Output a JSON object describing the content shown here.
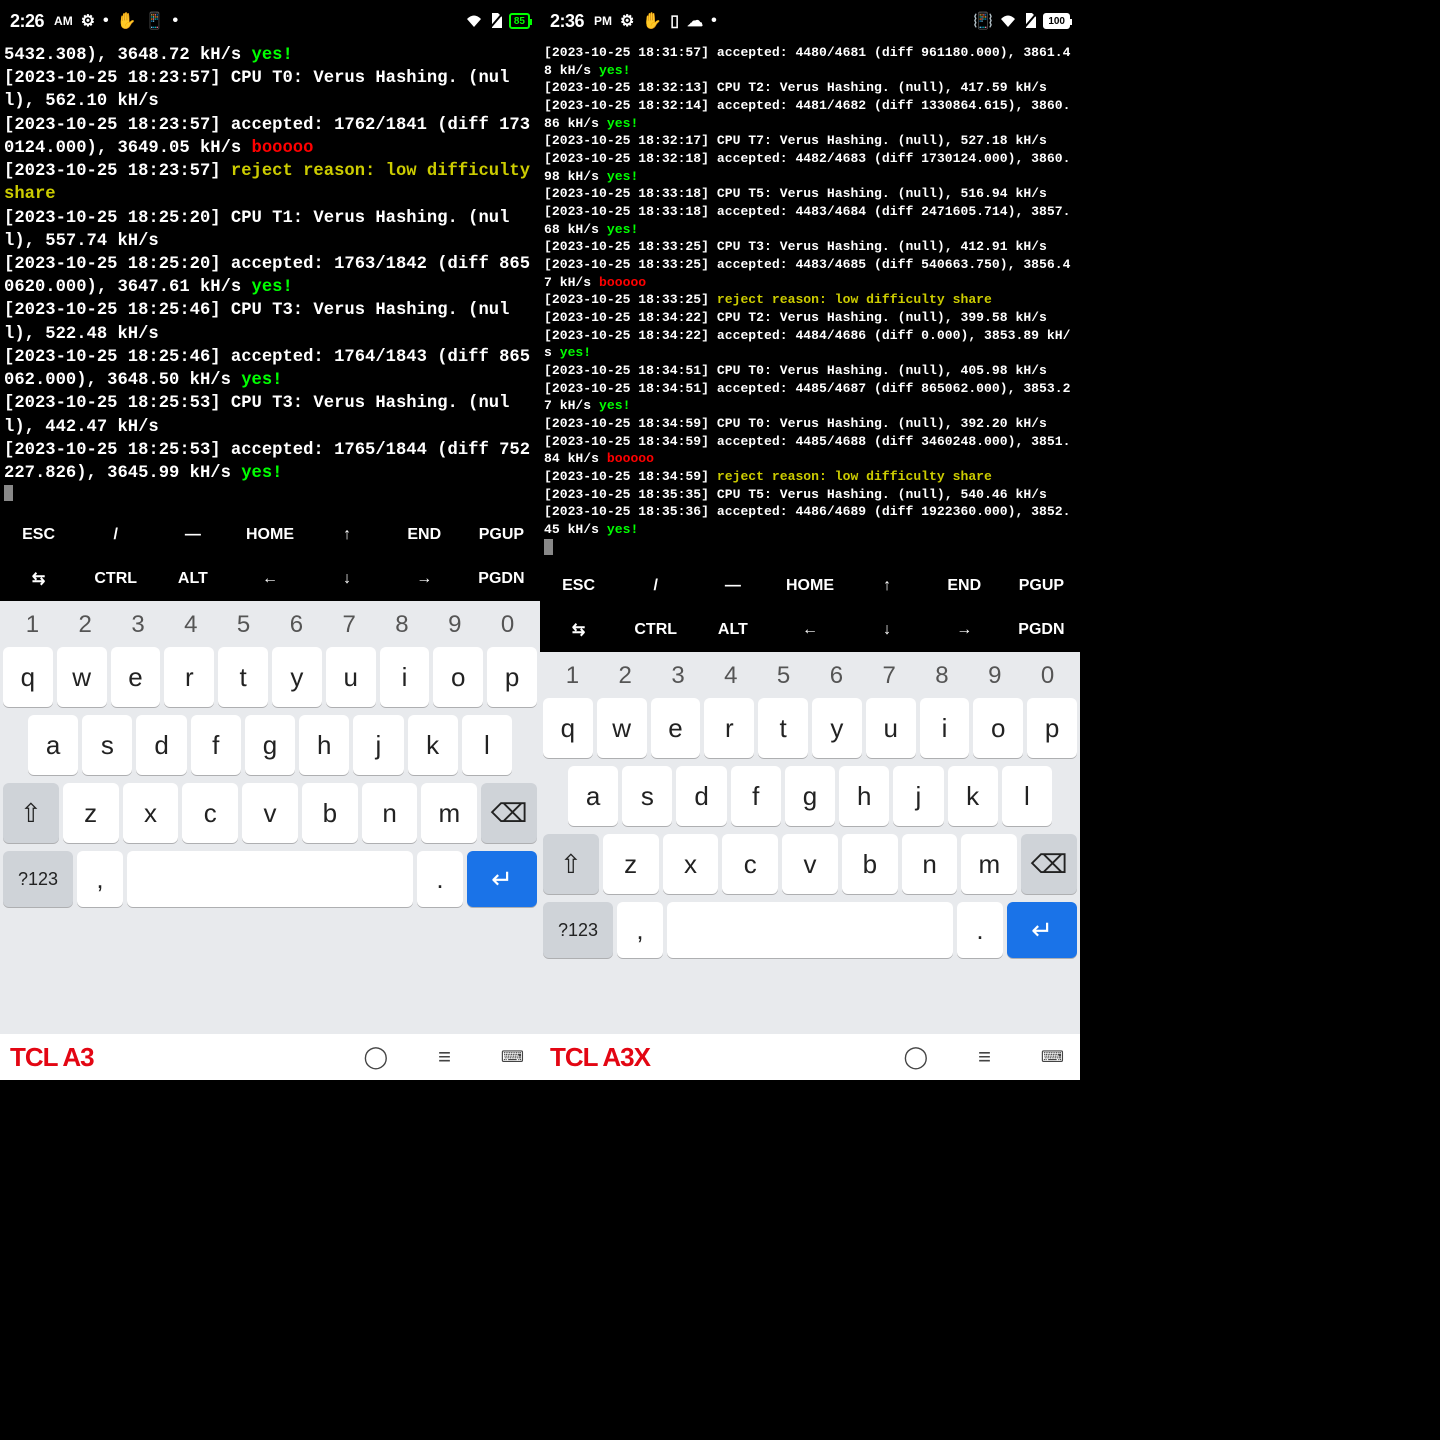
{
  "left": {
    "status": {
      "time": "2:26",
      "ampm": "AM",
      "batt": "85"
    },
    "fn": [
      "ESC",
      "/",
      "—",
      "HOME",
      "↑",
      "END",
      "PGUP"
    ],
    "fn2": [
      "⇆",
      "CTRL",
      "ALT",
      "←",
      "↓",
      "→",
      "PGDN"
    ],
    "numrow": [
      "1",
      "2",
      "3",
      "4",
      "5",
      "6",
      "7",
      "8",
      "9",
      "0"
    ],
    "row1": [
      "q",
      "w",
      "e",
      "r",
      "t",
      "y",
      "u",
      "i",
      "o",
      "p"
    ],
    "row2": [
      "a",
      "s",
      "d",
      "f",
      "g",
      "h",
      "j",
      "k",
      "l"
    ],
    "row3": [
      "z",
      "x",
      "c",
      "v",
      "b",
      "n",
      "m"
    ],
    "sym": "?123",
    "brand": "TCL A3",
    "lines": [
      {
        "pre": "5432.308), 3648.72 kH/s ",
        "tag": "yes!",
        "cls": "y"
      },
      {
        "ts": "[2023-10-25 18:23:57] ",
        "txt": "CPU T0: Verus Hashing. (null), 562.10 kH/s"
      },
      {
        "ts": "[2023-10-25 18:23:57] ",
        "txt": "accepted: 1762/1841 (diff 1730124.000), 3649.05 kH/s ",
        "tag": "booooo",
        "cls": "b"
      },
      {
        "ts": "[2023-10-25 18:23:57] ",
        "rj": "reject reason: low difficulty share"
      },
      {
        "ts": "[2023-10-25 18:25:20] ",
        "txt": "CPU T1: Verus Hashing. (null), 557.74 kH/s"
      },
      {
        "ts": "[2023-10-25 18:25:20] ",
        "txt": "accepted: 1763/1842 (diff 8650620.000), 3647.61 kH/s ",
        "tag": "yes!",
        "cls": "y"
      },
      {
        "ts": "[2023-10-25 18:25:46] ",
        "txt": "CPU T3: Verus Hashing. (null), 522.48 kH/s"
      },
      {
        "ts": "[2023-10-25 18:25:46] ",
        "txt": "accepted: 1764/1843 (diff 865062.000), 3648.50 kH/s ",
        "tag": "yes!",
        "cls": "y"
      },
      {
        "ts": "[2023-10-25 18:25:53] ",
        "txt": "CPU T3: Verus Hashing. (null), 442.47 kH/s"
      },
      {
        "ts": "[2023-10-25 18:25:53] ",
        "txt": "accepted: 1765/1844 (diff 752227.826), 3645.99 kH/s ",
        "tag": "yes!",
        "cls": "y"
      }
    ]
  },
  "right": {
    "status": {
      "time": "2:36",
      "ampm": "PM",
      "batt": "100"
    },
    "fn": [
      "ESC",
      "/",
      "—",
      "HOME",
      "↑",
      "END",
      "PGUP"
    ],
    "fn2": [
      "⇆",
      "CTRL",
      "ALT",
      "←",
      "↓",
      "→",
      "PGDN"
    ],
    "numrow": [
      "1",
      "2",
      "3",
      "4",
      "5",
      "6",
      "7",
      "8",
      "9",
      "0"
    ],
    "row1": [
      "q",
      "w",
      "e",
      "r",
      "t",
      "y",
      "u",
      "i",
      "o",
      "p"
    ],
    "row2": [
      "a",
      "s",
      "d",
      "f",
      "g",
      "h",
      "j",
      "k",
      "l"
    ],
    "row3": [
      "z",
      "x",
      "c",
      "v",
      "b",
      "n",
      "m"
    ],
    "sym": "?123",
    "brand": "TCL A3X",
    "lines": [
      {
        "ts": "[2023-10-25 18:31:57] ",
        "txt": "accepted: 4480/4681 (diff 961180.000), 3861.48 kH/s ",
        "tag": "yes!",
        "cls": "y"
      },
      {
        "ts": "[2023-10-25 18:32:13] ",
        "txt": "CPU T2: Verus Hashing. (null), 417.59 kH/s"
      },
      {
        "ts": "[2023-10-25 18:32:14] ",
        "txt": "accepted: 4481/4682 (diff 1330864.615), 3860.86 kH/s ",
        "tag": "yes!",
        "cls": "y"
      },
      {
        "ts": "[2023-10-25 18:32:17] ",
        "txt": "CPU T7: Verus Hashing. (null), 527.18 kH/s"
      },
      {
        "ts": "[2023-10-25 18:32:18] ",
        "txt": "accepted: 4482/4683 (diff 1730124.000), 3860.98 kH/s ",
        "tag": "yes!",
        "cls": "y"
      },
      {
        "ts": "[2023-10-25 18:33:18] ",
        "txt": "CPU T5: Verus Hashing. (null), 516.94 kH/s"
      },
      {
        "ts": "[2023-10-25 18:33:18] ",
        "txt": "accepted: 4483/4684 (diff 2471605.714), 3857.68 kH/s ",
        "tag": "yes!",
        "cls": "y"
      },
      {
        "ts": "[2023-10-25 18:33:25] ",
        "txt": "CPU T3: Verus Hashing. (null), 412.91 kH/s"
      },
      {
        "ts": "[2023-10-25 18:33:25] ",
        "txt": "accepted: 4483/4685 (diff 540663.750), 3856.47 kH/s ",
        "tag": "booooo",
        "cls": "b"
      },
      {
        "ts": "[2023-10-25 18:33:25] ",
        "rj": "reject reason: low difficulty share"
      },
      {
        "ts": "[2023-10-25 18:34:22] ",
        "txt": "CPU T2: Verus Hashing. (null), 399.58 kH/s"
      },
      {
        "ts": "[2023-10-25 18:34:22] ",
        "txt": "accepted: 4484/4686 (diff 0.000), 3853.89 kH/s ",
        "tag": "yes!",
        "cls": "y"
      },
      {
        "ts": "[2023-10-25 18:34:51] ",
        "txt": "CPU T0: Verus Hashing. (null), 405.98 kH/s"
      },
      {
        "ts": "[2023-10-25 18:34:51] ",
        "txt": "accepted: 4485/4687 (diff 865062.000), 3853.27 kH/s ",
        "tag": "yes!",
        "cls": "y"
      },
      {
        "ts": "[2023-10-25 18:34:59] ",
        "txt": "CPU T0: Verus Hashing. (null), 392.20 kH/s"
      },
      {
        "ts": "[2023-10-25 18:34:59] ",
        "txt": "accepted: 4485/4688 (diff 3460248.000), 3851.84 kH/s ",
        "tag": "booooo",
        "cls": "b"
      },
      {
        "ts": "[2023-10-25 18:34:59] ",
        "rj": "reject reason: low difficulty share"
      },
      {
        "ts": "[2023-10-25 18:35:35] ",
        "txt": "CPU T5: Verus Hashing. (null), 540.46 kH/s"
      },
      {
        "ts": "[2023-10-25 18:35:36] ",
        "txt": "accepted: 4486/4689 (diff 1922360.000), 3852.45 kH/s ",
        "tag": "yes!",
        "cls": "y"
      }
    ]
  }
}
